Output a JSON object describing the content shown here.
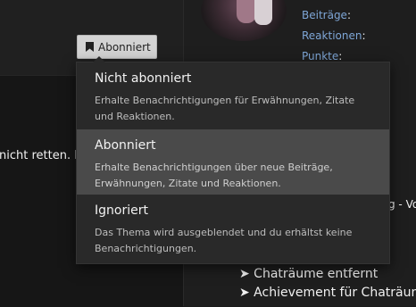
{
  "subscribe_button": {
    "icon": "bookmark-icon",
    "label": "Abonniert"
  },
  "profile_stats": [
    {
      "label": "Beiträge",
      "value": ""
    },
    {
      "label": "Reaktionen",
      "value": ""
    },
    {
      "label": "Punkte",
      "value": ""
    }
  ],
  "background_text": {
    "line1": "nicht retten. D",
    "line2": "g - Vor",
    "bullet1": "➤ Chaträume entfernt",
    "bullet2": "➤ Achievement für Chaträume"
  },
  "menu": {
    "options": [
      {
        "title": "Nicht abonniert",
        "desc_line1": "Erhalte Benachrichtigungen für Erwähnungen, Zitate",
        "desc_line2": "und Reaktionen."
      },
      {
        "title": "Abonniert",
        "desc_line1": "Erhalte Benachrichtigungen über neue Beiträge,",
        "desc_line2": "Erwähnungen, Zitate und Reaktionen."
      },
      {
        "title": "Ignoriert",
        "desc_line1": "Das Thema wird ausgeblendet und du erhältst keine",
        "desc_line2": "Benachrichtigungen."
      }
    ],
    "selected": "Abonniert"
  },
  "colors": {
    "link": "#7ea6d6",
    "menu_bg": "#292929",
    "active_bg": "#4a4a4a",
    "button_bg": "#d3d3d3"
  }
}
